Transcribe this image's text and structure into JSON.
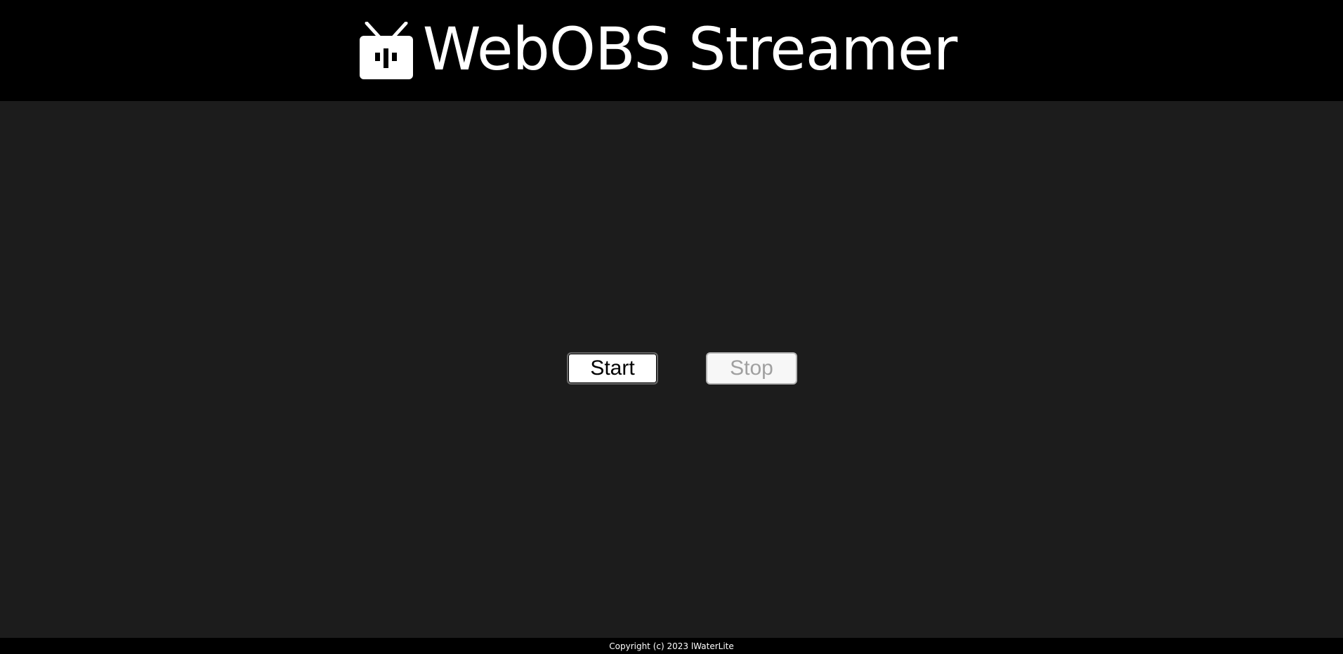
{
  "header": {
    "title": "WebOBS Streamer",
    "logo_icon": "tv-icon",
    "background_color": "#000000",
    "text_color": "#ffffff"
  },
  "main": {
    "background_color": "#1c1c1c",
    "controls": {
      "start_label": "Start",
      "stop_label": "Stop",
      "stop_disabled": true
    }
  },
  "footer": {
    "copyright": "Copyright (c) 2023 lWaterLite",
    "background_color": "#000000"
  }
}
